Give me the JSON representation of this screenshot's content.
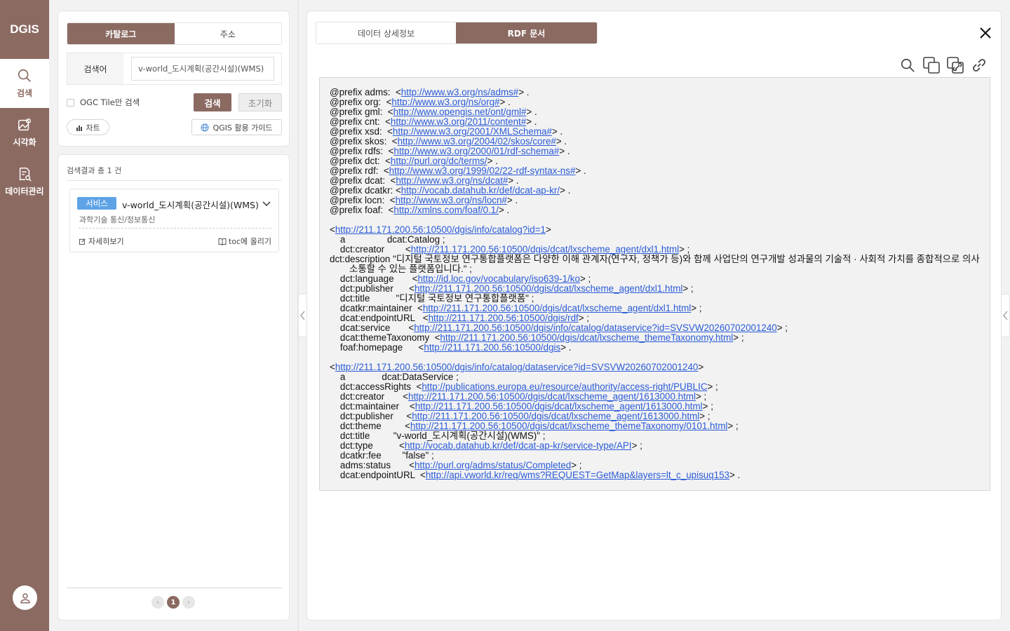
{
  "app": {
    "logo": "DGIS"
  },
  "rail": {
    "items": [
      {
        "label": "검색",
        "icon": "search-icon",
        "active": true
      },
      {
        "label": "시각화",
        "icon": "map-visualize-icon",
        "active": false
      },
      {
        "label": "데이터관리",
        "icon": "data-manage-icon",
        "active": false
      }
    ],
    "user_icon": "user-icon"
  },
  "search": {
    "tabs": [
      "카탈로그",
      "주소"
    ],
    "keyword_label": "검색어",
    "keyword_value": "v-world_도시계획(공간시설)(WMS)",
    "ogc_label": "OGC Tile만 검색",
    "search_button": "검색",
    "reset_button": "초기화",
    "chart_button": "차트",
    "guide_button": "QGIS 활용 가이드"
  },
  "results": {
    "count_text": "검색결과 총 1 건",
    "items": [
      {
        "badge": "서비스",
        "title": "v-world_도시계획(공간시설)(WMS)",
        "subtitle": "과학기술 통신/정보통신",
        "detail_link": "자세히보기",
        "toc_link": "toc에 올리기"
      }
    ],
    "pager": {
      "current": "1",
      "prev": "‹",
      "next": "›"
    }
  },
  "detail": {
    "tabs": [
      "데이터 상세정보",
      "RDF 문서"
    ],
    "active_tab": 1,
    "tools": [
      "search-icon",
      "copy-icon",
      "copy-link-icon",
      "link-icon"
    ],
    "rdf": {
      "prefixes": [
        {
          "pre": "@prefix adms:  <",
          "url": "http://www.w3.org/ns/adms#",
          "post": "> ."
        },
        {
          "pre": "@prefix org:  <",
          "url": "http://www.w3.org/ns/org#",
          "post": "> ."
        },
        {
          "pre": "@prefix gml:  <",
          "url": "http://www.opengis.net/ont/gml#",
          "post": "> ."
        },
        {
          "pre": "@prefix cnt:  <",
          "url": "http://www.w3.org/2011/content#",
          "post": "> ."
        },
        {
          "pre": "@prefix xsd:  <",
          "url": "http://www.w3.org/2001/XMLSchema#",
          "post": "> ."
        },
        {
          "pre": "@prefix skos:  <",
          "url": "http://www.w3.org/2004/02/skos/core#",
          "post": "> ."
        },
        {
          "pre": "@prefix rdfs:  <",
          "url": "http://www.w3.org/2000/01/rdf-schema#",
          "post": "> ."
        },
        {
          "pre": "@prefix dct:  <",
          "url": "http://purl.org/dc/terms/",
          "post": "> ."
        },
        {
          "pre": "@prefix rdf:  <",
          "url": "http://www.w3.org/1999/02/22-rdf-syntax-ns#",
          "post": "> ."
        },
        {
          "pre": "@prefix dcat:  <",
          "url": "http://www.w3.org/ns/dcat#",
          "post": "> ."
        },
        {
          "pre": "@prefix dcatkr: <",
          "url": "http://vocab.datahub.kr/def/dcat-ap-kr/",
          "post": "> ."
        },
        {
          "pre": "@prefix locn:  <",
          "url": "http://www.w3.org/ns/locn#",
          "post": "> ."
        },
        {
          "pre": "@prefix foaf:  <",
          "url": "http://xmlns.com/foaf/0.1/",
          "post": "> ."
        }
      ],
      "blocks": [
        {
          "subject": "http://211.171.200.56:10500/dgis/info/catalog?id=1",
          "lines": [
            {
              "pre": "    a                dcat:Catalog ;"
            },
            {
              "pre": "    dct:creator        <",
              "url": "http://211.171.200.56:10500/dgis/dcat/lxscheme_agent/dxl1.html",
              "post": "> ;"
            },
            {
              "pre": "    dct:description    \"디지털 국토정보 연구통합플랫폼은 다양한 이해 관계자(연구자, 정책가 등)와 함께 사업단의 연구개발 성과물의 기술적 · 사회적 가치를  종합적으로 의사소통할 수 있는 플랫폼입니다.\" ;",
              "wrap": true
            },
            {
              "pre": "    dct:language       <",
              "url": "http://id.loc.gov/vocabulary/iso639-1/ko",
              "post": "> ;"
            },
            {
              "pre": "    dct:publisher      <",
              "url": "http://211.171.200.56:10500/dgis/dcat/lxscheme_agent/dxl1.html",
              "post": "> ;"
            },
            {
              "pre": "    dct:title          \"디지털 국토정보 연구통합플랫폼\" ;"
            },
            {
              "pre": "    dcatkr:maintainer  <",
              "url": "http://211.171.200.56:10500/dgis/dcat/lxscheme_agent/dxl1.html",
              "post": "> ;"
            },
            {
              "pre": "    dcat:endpointURL   <",
              "url": "http://211.171.200.56:10500/dgis/rdf",
              "post": "> ;"
            },
            {
              "pre": "    dcat:service       <",
              "url": "http://211.171.200.56:10500/dgis/info/catalog/dataservice?id=SVSVW20260702001240",
              "post": "> ;"
            },
            {
              "pre": "    dcat:themeTaxonomy  <",
              "url": "http://211.171.200.56:10500/dgis/dcat/lxscheme_themeTaxonomy.html",
              "post": "> ;"
            },
            {
              "pre": "    foaf:homepage      <",
              "url": "http://211.171.200.56:10500/dgis",
              "post": "> ."
            }
          ]
        },
        {
          "subject": "http://211.171.200.56:10500/dgis/info/catalog/dataservice?id=SVSVW20260702001240",
          "lines": [
            {
              "pre": "    a              dcat:DataService ;"
            },
            {
              "pre": "    dct:accessRights  <",
              "url": "http://publications.europa.eu/resource/authority/access-right/PUBLIC",
              "post": "> ;"
            },
            {
              "pre": "    dct:creator       <",
              "url": "http://211.171.200.56:10500/dgis/dcat/lxscheme_agent/1613000.html",
              "post": "> ;"
            },
            {
              "pre": "    dct:maintainer    <",
              "url": "http://211.171.200.56:10500/dgis/dcat/lxscheme_agent/1613000.html",
              "post": "> ;"
            },
            {
              "pre": "    dct:publisher     <",
              "url": "http://211.171.200.56:10500/dgis/dcat/lxscheme_agent/1613000.html",
              "post": "> ;"
            },
            {
              "pre": "    dct:theme         <",
              "url": "http://211.171.200.56:10500/dgis/dcat/lxscheme_themeTaxonomy/0101.html",
              "post": "> ;"
            },
            {
              "pre": "    dct:title         \"v-world_도시계획(공간시설)(WMS)\" ;"
            },
            {
              "pre": "    dct:type          <",
              "url": "http://vocab.datahub.kr/def/dcat-ap-kr/service-type/API",
              "post": "> ;"
            },
            {
              "pre": "    dcatkr:fee        \"false\" ;"
            },
            {
              "pre": "    adms:status       <",
              "url": "http://purl.org/adms/status/Completed",
              "post": "> ;"
            },
            {
              "pre": "    dcat:endpointURL  <",
              "url": "http://api.vworld.kr/req/wms?REQUEST=GetMap&layers=lt_c_upisuq153",
              "post": "> ."
            }
          ]
        }
      ]
    }
  },
  "colors": {
    "brand": "#8b6a62",
    "badge": "#5ea3e6",
    "link": "#2a5bd7"
  }
}
